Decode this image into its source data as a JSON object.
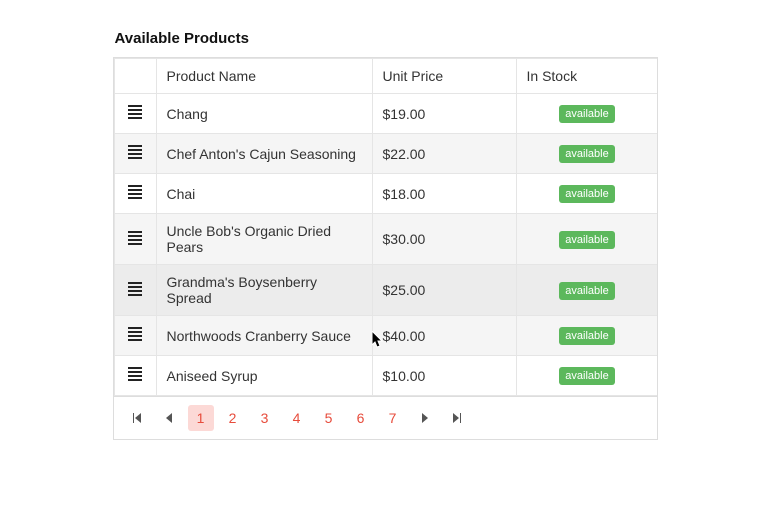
{
  "title": "Available Products",
  "columns": {
    "name": "Product Name",
    "price": "Unit Price",
    "stock": "In Stock"
  },
  "rows": [
    {
      "name": "Chang",
      "price": "$19.00",
      "stock": "available"
    },
    {
      "name": "Chef Anton's Cajun Seasoning",
      "price": "$22.00",
      "stock": "available"
    },
    {
      "name": "Chai",
      "price": "$18.00",
      "stock": "available"
    },
    {
      "name": "Uncle Bob's Organic Dried Pears",
      "price": "$30.00",
      "stock": "available"
    },
    {
      "name": "Grandma's Boysenberry Spread",
      "price": "$25.00",
      "stock": "available"
    },
    {
      "name": "Northwoods Cranberry Sauce",
      "price": "$40.00",
      "stock": "available"
    },
    {
      "name": "Aniseed Syrup",
      "price": "$10.00",
      "stock": "available"
    }
  ],
  "hoverRow": 4,
  "pager": {
    "pages": [
      "1",
      "2",
      "3",
      "4",
      "5",
      "6",
      "7"
    ],
    "selected": "1"
  }
}
